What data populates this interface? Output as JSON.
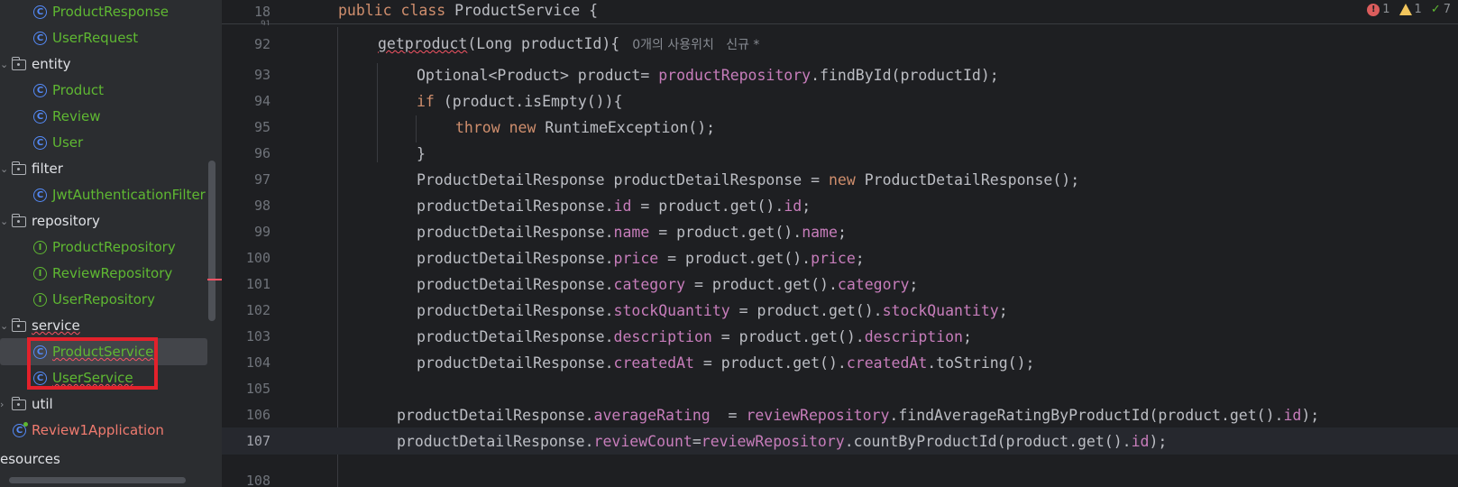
{
  "sidebar": {
    "items": [
      {
        "label": "ProductResponse",
        "kind": "class"
      },
      {
        "label": "UserRequest",
        "kind": "class"
      },
      {
        "label": "entity",
        "kind": "folder"
      },
      {
        "label": "Product",
        "kind": "class"
      },
      {
        "label": "Review",
        "kind": "class"
      },
      {
        "label": "User",
        "kind": "class"
      },
      {
        "label": "filter",
        "kind": "folder"
      },
      {
        "label": "JwtAuthenticationFilter",
        "kind": "class"
      },
      {
        "label": "repository",
        "kind": "folder"
      },
      {
        "label": "ProductRepository",
        "kind": "interface"
      },
      {
        "label": "ReviewRepository",
        "kind": "interface"
      },
      {
        "label": "UserRepository",
        "kind": "interface"
      },
      {
        "label": "service",
        "kind": "folder"
      },
      {
        "label": "ProductService",
        "kind": "class",
        "selected": true
      },
      {
        "label": "UserService",
        "kind": "class"
      },
      {
        "label": "util",
        "kind": "folder"
      },
      {
        "label": "Review1Application",
        "kind": "app"
      },
      {
        "label": "esources",
        "kind": "folder"
      }
    ],
    "icon_letters": {
      "class": "C",
      "interface": "I"
    }
  },
  "editor": {
    "sticky": {
      "line_no": "18",
      "text_kw": "public class ",
      "text": "ProductService {"
    },
    "partial_line_no": "91",
    "status": {
      "errors": "1",
      "warnings": "1",
      "ok": "7"
    },
    "lines": [
      {
        "no": "92",
        "m": "getproduct",
        "sig": "(Long productId){",
        "inlay": "0개의 사용위치   신규 *"
      },
      {
        "no": "93",
        "a": "Optional<Product> product= ",
        "f": "productRepository",
        "b": ".findById(productId);"
      },
      {
        "no": "94",
        "kw": "if",
        "b": " (product.isEmpty()){"
      },
      {
        "no": "95",
        "kw": "throw new",
        "b": " RuntimeException();"
      },
      {
        "no": "96",
        "b": "}"
      },
      {
        "no": "97",
        "a": "ProductDetailResponse productDetailResponse = ",
        "kw": "new",
        "b": " ProductDetailResponse();"
      },
      {
        "no": "98",
        "a": "productDetailResponse.",
        "f": "id",
        "b": " = product.get().",
        "f2": "id",
        "c": ";"
      },
      {
        "no": "99",
        "a": "productDetailResponse.",
        "f": "name",
        "b": " = product.get().",
        "f2": "name",
        "c": ";"
      },
      {
        "no": "100",
        "a": "productDetailResponse.",
        "f": "price",
        "b": " = product.get().",
        "f2": "price",
        "c": ";"
      },
      {
        "no": "101",
        "a": "productDetailResponse.",
        "f": "category",
        "b": " = product.get().",
        "f2": "category",
        "c": ";"
      },
      {
        "no": "102",
        "a": "productDetailResponse.",
        "f": "stockQuantity",
        "b": " = product.get().",
        "f2": "stockQuantity",
        "c": ";"
      },
      {
        "no": "103",
        "a": "productDetailResponse.",
        "f": "description",
        "b": " = product.get().",
        "f2": "description",
        "c": ";"
      },
      {
        "no": "104",
        "a": "productDetailResponse.",
        "f": "createdAt",
        "b": " = product.get().",
        "f2": "createdAt",
        "c": ".toString();"
      },
      {
        "no": "105"
      },
      {
        "no": "106",
        "a": "productDetailResponse.",
        "f": "averageRating",
        "b": "  = ",
        "f2": "reviewRepository",
        "c": ".findAverageRatingByProductId(product.get().",
        "f3": "id",
        "d": ");"
      },
      {
        "no": "107",
        "a": "productDetailResponse.",
        "f": "reviewCount",
        "b": "=",
        "f2": "reviewRepository",
        "c": ".countByProductId(product.get().",
        "f3": "id",
        "d": ");"
      },
      {
        "no": "108"
      }
    ]
  }
}
